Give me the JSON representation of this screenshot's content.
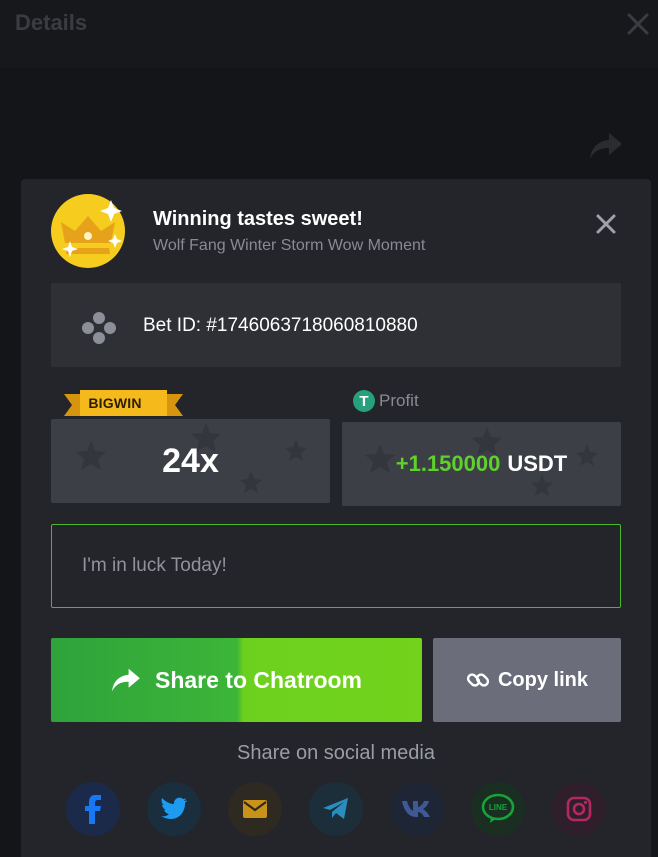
{
  "page": {
    "title": "Details"
  },
  "modal": {
    "title": "Winning tastes sweet!",
    "subtitle": "Wolf Fang Winter Storm Wow Moment",
    "bet_id": "Bet ID: #1746063718060810880",
    "badge": "BIGWIN",
    "multiplier": "24x",
    "profit_label": "Profit",
    "profit_currency_symbol": "T",
    "profit_amount": "+1.150000",
    "profit_currency": "USDT",
    "message_placeholder": "I'm in luck Today!",
    "share_button": "Share to Chatroom",
    "copy_button": "Copy link",
    "social_title": "Share on social media",
    "social": [
      {
        "icon": "facebook-icon",
        "color": "#1877f2"
      },
      {
        "icon": "twitter-icon",
        "color": "#1d9bf0"
      },
      {
        "icon": "email-icon",
        "color": "#c9931a"
      },
      {
        "icon": "telegram-icon",
        "color": "#2a8dc0"
      },
      {
        "icon": "vk-icon",
        "color": "#3d5a96"
      },
      {
        "icon": "line-icon",
        "color": "#16a33a"
      },
      {
        "icon": "instagram-icon",
        "color": "#b5285f"
      }
    ],
    "colors": {
      "accent_green": "#5fd12b",
      "badge_yellow": "#f6b91c"
    }
  }
}
